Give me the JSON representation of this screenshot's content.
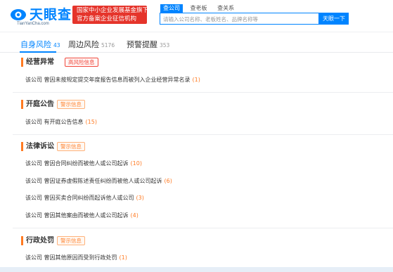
{
  "header": {
    "logo_text": "天眼查",
    "logo_sub": "TianYanCha.com",
    "badge_line1": "国家中小企业发展基金旗下",
    "badge_line2": "官方备案企业征信机构",
    "search_tabs": [
      "查公司",
      "查老板",
      "查关系"
    ],
    "search_placeholder": "请输入公司名称、老板姓名、品牌名称等",
    "search_button": "天眼一下",
    "colors": {
      "brand": "#0084ff",
      "badge": "#e5342b"
    }
  },
  "tabs": [
    {
      "label": "自身风险",
      "count": "43"
    },
    {
      "label": "周边风险",
      "count": "5176"
    },
    {
      "label": "预警提醒",
      "count": "353"
    }
  ],
  "sections": [
    {
      "title": "经营异常",
      "tag": "高风险信息",
      "items": [
        {
          "text": "该公司 曾因未按规定提交年度报告信息而被列入企业经营异常名录",
          "count": "(1)"
        }
      ]
    },
    {
      "title": "开庭公告",
      "tag": "警示信息",
      "items": [
        {
          "text": "该公司 有开庭公告信息",
          "count": "(15)"
        }
      ]
    },
    {
      "title": "法律诉讼",
      "tag": "警示信息",
      "items": [
        {
          "text": "该公司 曾因合同纠纷而被他人或公司起诉",
          "count": "(10)"
        },
        {
          "text": "该公司 曾因证券虚假陈述责任纠纷而被他人或公司起诉",
          "count": "(6)"
        },
        {
          "text": "该公司 曾因买卖合同纠纷而起诉他人或公司",
          "count": "(3)"
        },
        {
          "text": "该公司 曾因其他案由而被他人或公司起诉",
          "count": "(4)"
        }
      ]
    },
    {
      "title": "行政处罚",
      "tag": "警示信息",
      "items": [
        {
          "text": "该公司 曾因其他原因而受到行政处罚",
          "count": "(1)"
        }
      ]
    }
  ]
}
